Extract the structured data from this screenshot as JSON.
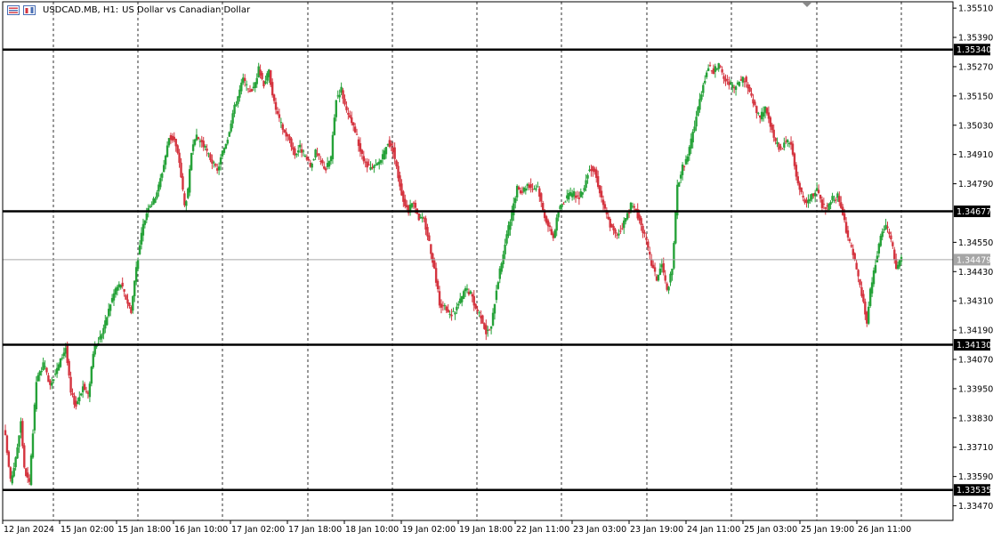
{
  "window": {
    "symbol_label": "USDCAD.MB, H1:",
    "description": "US Dollar vs Canadian Dollar",
    "icon_names": [
      "list-icon",
      "one-click-trading-icon"
    ]
  },
  "colors": {
    "bull": "#26a239",
    "bear": "#d4343f",
    "background": "#ffffff",
    "axis": "#000000",
    "grid": "#000000",
    "level_line": "#000000",
    "bid_line": "#a6a6a6"
  },
  "chart_data": {
    "type": "candlestick",
    "symbol": "USDCAD.MB",
    "timeframe": "H1",
    "ylim": [
      1.3341,
      1.35536
    ],
    "grid": "vertical dashed",
    "x_tick_labels": [
      "12 Jan 2024",
      "15 Jan 02:00",
      "15 Jan 18:00",
      "16 Jan 10:00",
      "17 Jan 02:00",
      "17 Jan 18:00",
      "18 Jan 10:00",
      "19 Jan 02:00",
      "19 Jan 18:00",
      "22 Jan 11:00",
      "23 Jan 03:00",
      "23 Jan 19:00",
      "24 Jan 11:00",
      "25 Jan 03:00",
      "25 Jan 19:00",
      "26 Jan 11:00"
    ],
    "y_tick_labels": [
      "1.35510",
      "1.35390",
      "1.35270",
      "1.35150",
      "1.35030",
      "1.34910",
      "1.34790",
      "1.34550",
      "1.34430",
      "1.34310",
      "1.34190",
      "1.34070",
      "1.33950",
      "1.33830",
      "1.33710",
      "1.33590",
      "1.33470"
    ],
    "y_ticks": [
      1.3551,
      1.3539,
      1.3527,
      1.3515,
      1.3503,
      1.3491,
      1.3479,
      1.3455,
      1.3443,
      1.3431,
      1.3419,
      1.3407,
      1.3395,
      1.3383,
      1.3371,
      1.3359,
      1.3347
    ],
    "levels": [
      {
        "value": 1.3534,
        "label": "1.35340"
      },
      {
        "value": 1.34677,
        "label": "1.34677"
      },
      {
        "value": 1.3413,
        "label": "1.34130"
      },
      {
        "value": 1.33535,
        "label": "1.33535"
      }
    ],
    "current_price": {
      "value": 1.34479,
      "label": "1.34479"
    },
    "keypoints": [
      [
        0,
        1.3375
      ],
      [
        3,
        1.3357
      ],
      [
        6,
        1.3366
      ],
      [
        9,
        1.3382
      ],
      [
        11,
        1.3362
      ],
      [
        14,
        1.3356
      ],
      [
        18,
        1.3398
      ],
      [
        22,
        1.3405
      ],
      [
        26,
        1.3397
      ],
      [
        30,
        1.3403
      ],
      [
        35,
        1.3412
      ],
      [
        38,
        1.3393
      ],
      [
        41,
        1.3388
      ],
      [
        45,
        1.3396
      ],
      [
        48,
        1.3392
      ],
      [
        51,
        1.341
      ],
      [
        55,
        1.3416
      ],
      [
        58,
        1.3422
      ],
      [
        61,
        1.343
      ],
      [
        64,
        1.3436
      ],
      [
        67,
        1.3438
      ],
      [
        70,
        1.3432
      ],
      [
        73,
        1.3427
      ],
      [
        76,
        1.3445
      ],
      [
        80,
        1.3462
      ],
      [
        83,
        1.347
      ],
      [
        86,
        1.3472
      ],
      [
        89,
        1.3478
      ],
      [
        92,
        1.3487
      ],
      [
        95,
        1.3498
      ],
      [
        98,
        1.3497
      ],
      [
        101,
        1.3488
      ],
      [
        104,
        1.347
      ],
      [
        106,
        1.3476
      ],
      [
        108,
        1.3492
      ],
      [
        111,
        1.3498
      ],
      [
        114,
        1.3496
      ],
      [
        117,
        1.3492
      ],
      [
        120,
        1.3488
      ],
      [
        123,
        1.3484
      ],
      [
        126,
        1.3492
      ],
      [
        129,
        1.3498
      ],
      [
        132,
        1.3508
      ],
      [
        135,
        1.3515
      ],
      [
        138,
        1.3522
      ],
      [
        141,
        1.3517
      ],
      [
        144,
        1.3518
      ],
      [
        147,
        1.3526
      ],
      [
        150,
        1.352
      ],
      [
        153,
        1.3525
      ],
      [
        156,
        1.3512
      ],
      [
        159,
        1.3505
      ],
      [
        162,
        1.35
      ],
      [
        165,
        1.3497
      ],
      [
        168,
        1.3491
      ],
      [
        171,
        1.3494
      ],
      [
        174,
        1.349
      ],
      [
        177,
        1.3486
      ],
      [
        180,
        1.3492
      ],
      [
        183,
        1.3488
      ],
      [
        186,
        1.3485
      ],
      [
        189,
        1.349
      ],
      [
        192,
        1.3514
      ],
      [
        195,
        1.3518
      ],
      [
        198,
        1.3508
      ],
      [
        201,
        1.3504
      ],
      [
        204,
        1.3498
      ],
      [
        207,
        1.349
      ],
      [
        210,
        1.3486
      ],
      [
        213,
        1.3485
      ],
      [
        216,
        1.3487
      ],
      [
        219,
        1.349
      ],
      [
        222,
        1.3496
      ],
      [
        225,
        1.3493
      ],
      [
        228,
        1.3482
      ],
      [
        231,
        1.3472
      ],
      [
        234,
        1.3468
      ],
      [
        237,
        1.3472
      ],
      [
        240,
        1.3465
      ],
      [
        243,
        1.3464
      ],
      [
        246,
        1.3455
      ],
      [
        249,
        1.3444
      ],
      [
        252,
        1.343
      ],
      [
        255,
        1.3428
      ],
      [
        258,
        1.3425
      ],
      [
        261,
        1.3427
      ],
      [
        264,
        1.3431
      ],
      [
        267,
        1.3436
      ],
      [
        270,
        1.3434
      ],
      [
        273,
        1.3428
      ],
      [
        276,
        1.3425
      ],
      [
        279,
        1.3418
      ],
      [
        282,
        1.342
      ],
      [
        285,
        1.3436
      ],
      [
        288,
        1.3447
      ],
      [
        291,
        1.3458
      ],
      [
        294,
        1.3467
      ],
      [
        297,
        1.3477
      ],
      [
        300,
        1.3476
      ],
      [
        303,
        1.3479
      ],
      [
        306,
        1.3477
      ],
      [
        309,
        1.3478
      ],
      [
        312,
        1.3468
      ],
      [
        315,
        1.3462
      ],
      [
        318,
        1.3457
      ],
      [
        321,
        1.3468
      ],
      [
        324,
        1.3472
      ],
      [
        327,
        1.3474
      ],
      [
        330,
        1.3475
      ],
      [
        333,
        1.3473
      ],
      [
        336,
        1.3478
      ],
      [
        339,
        1.3486
      ],
      [
        342,
        1.3484
      ],
      [
        345,
        1.3476
      ],
      [
        348,
        1.3468
      ],
      [
        351,
        1.3462
      ],
      [
        354,
        1.3458
      ],
      [
        357,
        1.346
      ],
      [
        360,
        1.3465
      ],
      [
        363,
        1.347
      ],
      [
        366,
        1.3468
      ],
      [
        369,
        1.3462
      ],
      [
        372,
        1.3455
      ],
      [
        375,
        1.3446
      ],
      [
        378,
        1.344
      ],
      [
        381,
        1.3446
      ],
      [
        384,
        1.3435
      ],
      [
        387,
        1.3444
      ],
      [
        390,
        1.3478
      ],
      [
        393,
        1.3486
      ],
      [
        396,
        1.349
      ],
      [
        399,
        1.35
      ],
      [
        402,
        1.351
      ],
      [
        405,
        1.352
      ],
      [
        408,
        1.3527
      ],
      [
        411,
        1.3525
      ],
      [
        414,
        1.3528
      ],
      [
        417,
        1.3522
      ],
      [
        420,
        1.352
      ],
      [
        423,
        1.3518
      ],
      [
        426,
        1.3521
      ],
      [
        429,
        1.3522
      ],
      [
        432,
        1.3517
      ],
      [
        435,
        1.351
      ],
      [
        438,
        1.3506
      ],
      [
        441,
        1.351
      ],
      [
        444,
        1.3503
      ],
      [
        447,
        1.3496
      ],
      [
        450,
        1.3493
      ],
      [
        453,
        1.3497
      ],
      [
        456,
        1.3495
      ],
      [
        459,
        1.3482
      ],
      [
        462,
        1.3475
      ],
      [
        465,
        1.347
      ],
      [
        468,
        1.3474
      ],
      [
        471,
        1.3476
      ],
      [
        474,
        1.347
      ],
      [
        477,
        1.3469
      ],
      [
        480,
        1.3473
      ],
      [
        483,
        1.3474
      ],
      [
        486,
        1.3466
      ],
      [
        489,
        1.3457
      ],
      [
        492,
        1.345
      ],
      [
        495,
        1.344
      ],
      [
        498,
        1.343
      ],
      [
        500,
        1.3422
      ],
      [
        502,
        1.3435
      ],
      [
        505,
        1.3446
      ],
      [
        508,
        1.3458
      ],
      [
        511,
        1.3462
      ],
      [
        514,
        1.3456
      ],
      [
        517,
        1.3445
      ],
      [
        520,
        1.3448
      ]
    ]
  }
}
